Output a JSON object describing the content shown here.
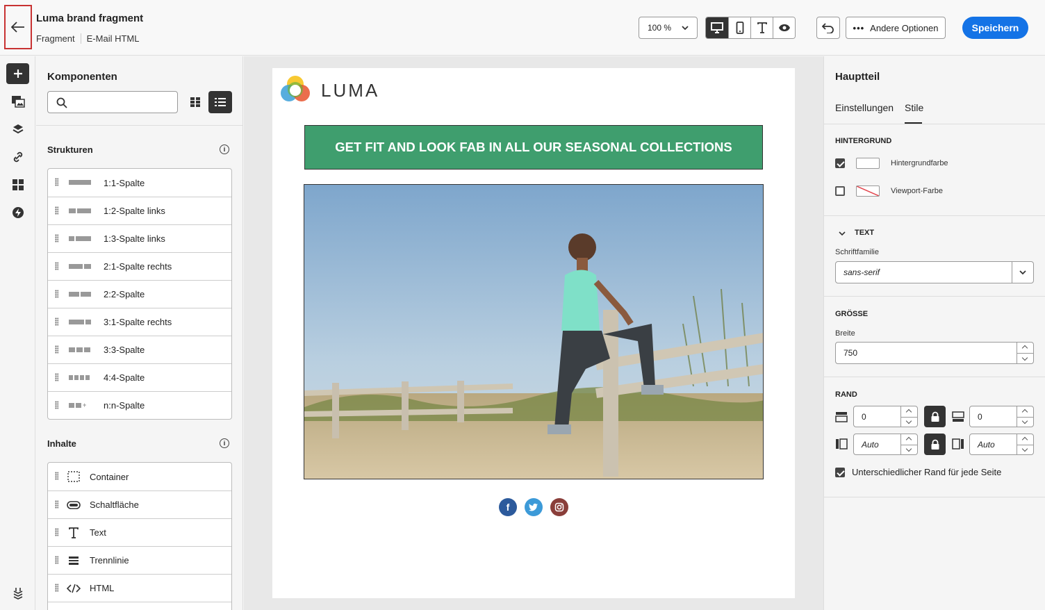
{
  "header": {
    "title": "Luma brand fragment",
    "breadcrumb": [
      "Fragment",
      "E-Mail HTML"
    ],
    "zoom": "100 %",
    "more_options": "Andere Optionen",
    "save": "Speichern"
  },
  "left_panel": {
    "title": "Komponenten",
    "search_placeholder": "",
    "structures_title": "Strukturen",
    "structures": [
      "1:1-Spalte",
      "1:2-Spalte links",
      "1:3-Spalte links",
      "2:1-Spalte rechts",
      "2:2-Spalte",
      "3:1-Spalte rechts",
      "3:3-Spalte",
      "4:4-Spalte",
      "n:n-Spalte"
    ],
    "contents_title": "Inhalte",
    "contents": [
      "Container",
      "Schaltfläche",
      "Text",
      "Trennlinie",
      "HTML"
    ]
  },
  "email": {
    "logo_text": "LUMA",
    "banner": "GET FIT AND LOOK FAB IN ALL OUR SEASONAL COLLECTIONS",
    "social": [
      "facebook",
      "twitter",
      "instagram"
    ]
  },
  "right_panel": {
    "title": "Hauptteil",
    "tabs": [
      "Einstellungen",
      "Stile"
    ],
    "active_tab": "Stile",
    "background_title": "HINTERGRUND",
    "background_color_label": "Hintergrundfarbe",
    "viewport_color_label": "Viewport-Farbe",
    "text_title": "TEXT",
    "font_family_label": "Schriftfamilie",
    "font_family_value": "sans-serif",
    "size_title": "GRÖSSE",
    "width_label": "Breite",
    "width_value": "750",
    "margin_title": "RAND",
    "margin_top": "0",
    "margin_bottom": "0",
    "margin_left": "Auto",
    "margin_right": "Auto",
    "different_margin_label": "Unterschiedlicher Rand für jede Seite"
  },
  "colors": {
    "accent": "#1473e6",
    "banner": "#3f9e6e"
  }
}
